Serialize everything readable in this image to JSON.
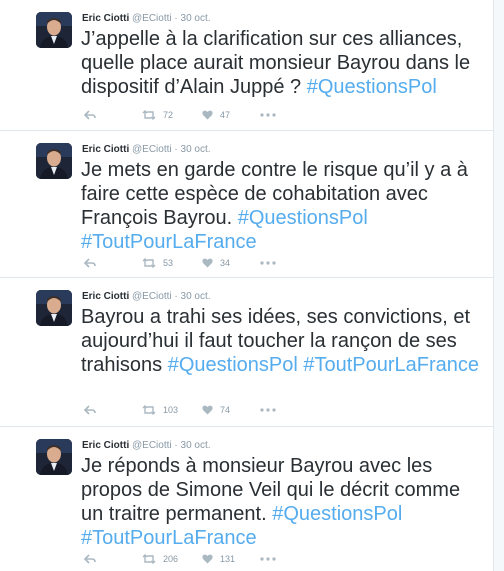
{
  "tweets": [
    {
      "name": "Eric Ciotti",
      "handle": "@ECiotti",
      "separator": "·",
      "time": "30 oct.",
      "text_parts": [
        {
          "t": "J’appelle à la clarification sur ces alliances, quelle place aurait monsieur Bayrou dans le dispositif d’Alain Juppé ? ",
          "tag": false
        },
        {
          "t": "#QuestionsPol",
          "tag": true
        }
      ],
      "retweets": "72",
      "likes": "47"
    },
    {
      "name": "Eric Ciotti",
      "handle": "@ECiotti",
      "separator": "·",
      "time": "30 oct.",
      "text_parts": [
        {
          "t": "Je mets en garde contre le risque qu’il y a à faire cette espèce de cohabitation avec François Bayrou. ",
          "tag": false
        },
        {
          "t": "#QuestionsPol",
          "tag": true
        },
        {
          "t": " ",
          "tag": false
        },
        {
          "t": "#ToutPourLaFrance",
          "tag": true
        }
      ],
      "retweets": "53",
      "likes": "34"
    },
    {
      "name": "Eric Ciotti",
      "handle": "@ECiotti",
      "separator": "·",
      "time": "30 oct.",
      "text_parts": [
        {
          "t": "Bayrou a trahi ses idées, ses convictions, et aujourd’hui il faut toucher la rançon de ses trahisons ",
          "tag": false
        },
        {
          "t": "#QuestionsPol",
          "tag": true
        },
        {
          "t": " ",
          "tag": false
        },
        {
          "t": "#ToutPourLaFrance",
          "tag": true
        }
      ],
      "retweets": "103",
      "likes": "74"
    },
    {
      "name": "Eric Ciotti",
      "handle": "@ECiotti",
      "separator": "·",
      "time": "30 oct.",
      "text_parts": [
        {
          "t": "Je réponds à monsieur Bayrou avec les propos de Simone Veil qui le décrit comme un traitre permanent. ",
          "tag": false
        },
        {
          "t": "#QuestionsPol",
          "tag": true
        },
        {
          "t": " ",
          "tag": false
        },
        {
          "t": "#ToutPourLaFrance",
          "tag": true
        }
      ],
      "retweets": "206",
      "likes": "131"
    }
  ],
  "icons": {
    "reply": "reply-icon",
    "retweet": "retweet-icon",
    "like": "heart-icon",
    "more": "more-icon"
  },
  "colors": {
    "hashtag": "#55acee",
    "text": "#292f33",
    "muted": "#8899a6",
    "divider": "#e1e8ed"
  }
}
